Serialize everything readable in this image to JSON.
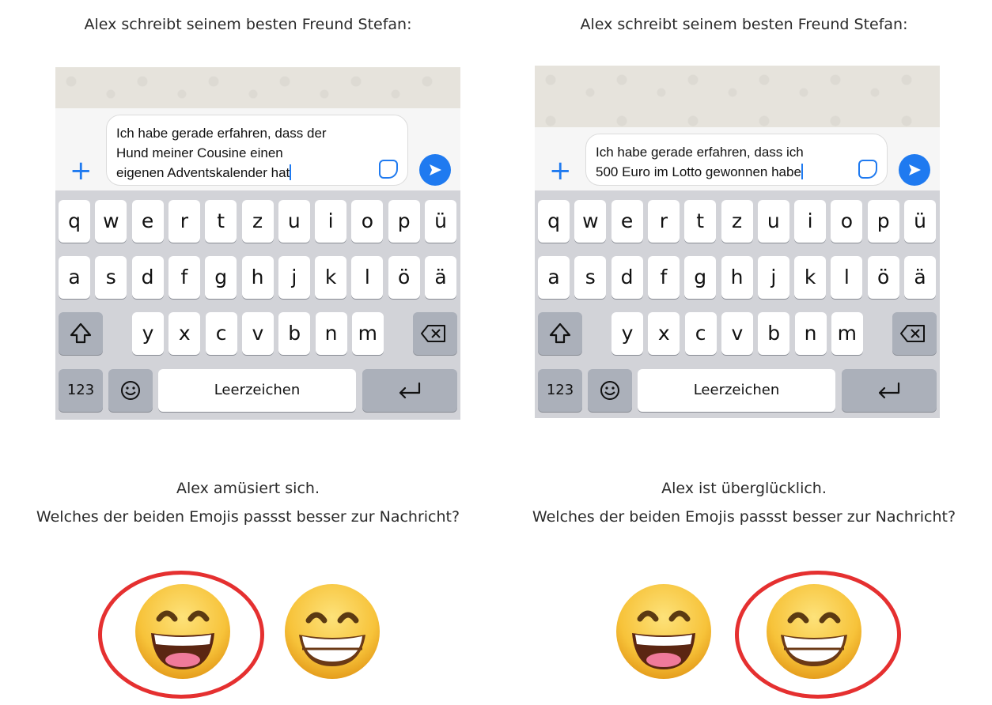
{
  "panels": [
    {
      "heading": "Alex schreibt seinem besten Freund Stefan:",
      "message": "Ich habe gerade erfahren, dass der\nHund meiner Cousine einen\neigenen Adventskalender hat",
      "mood": "Alex amüsiert sich.",
      "question": "Welches der beiden Emojis passst besser zur Nachricht?",
      "selected_emoji": "open-mouth-smile",
      "emojis": [
        "grinning-open-mouth-smiling-eyes",
        "beaming-face-smiling-eyes"
      ]
    },
    {
      "heading": "Alex schreibt seinem besten Freund Stefan:",
      "message": "Ich habe gerade erfahren, dass ich\n500 Euro im Lotto gewonnen habe",
      "mood": "Alex ist überglücklich.",
      "question": "Welches der beiden Emojis passst besser zur Nachricht?",
      "selected_emoji": "teeth-grin",
      "emojis": [
        "grinning-open-mouth-smiling-eyes",
        "beaming-face-smiling-eyes"
      ]
    }
  ],
  "keyboard": {
    "row1": [
      "q",
      "w",
      "e",
      "r",
      "t",
      "z",
      "u",
      "i",
      "o",
      "p",
      "ü"
    ],
    "row2": [
      "a",
      "s",
      "d",
      "f",
      "g",
      "h",
      "j",
      "k",
      "l",
      "ö",
      "ä"
    ],
    "row3": [
      "y",
      "x",
      "c",
      "v",
      "b",
      "n",
      "m"
    ],
    "numbers_label": "123",
    "space_label": "Leerzeichen",
    "shift_icon": "shift-icon",
    "delete_icon": "delete-icon",
    "emoji_icon": "emoji-key-icon",
    "return_icon": "return-icon"
  },
  "colors": {
    "accent": "#1f7af0",
    "circle": "#e53030",
    "emoji_yellow": "#f7c33a"
  }
}
